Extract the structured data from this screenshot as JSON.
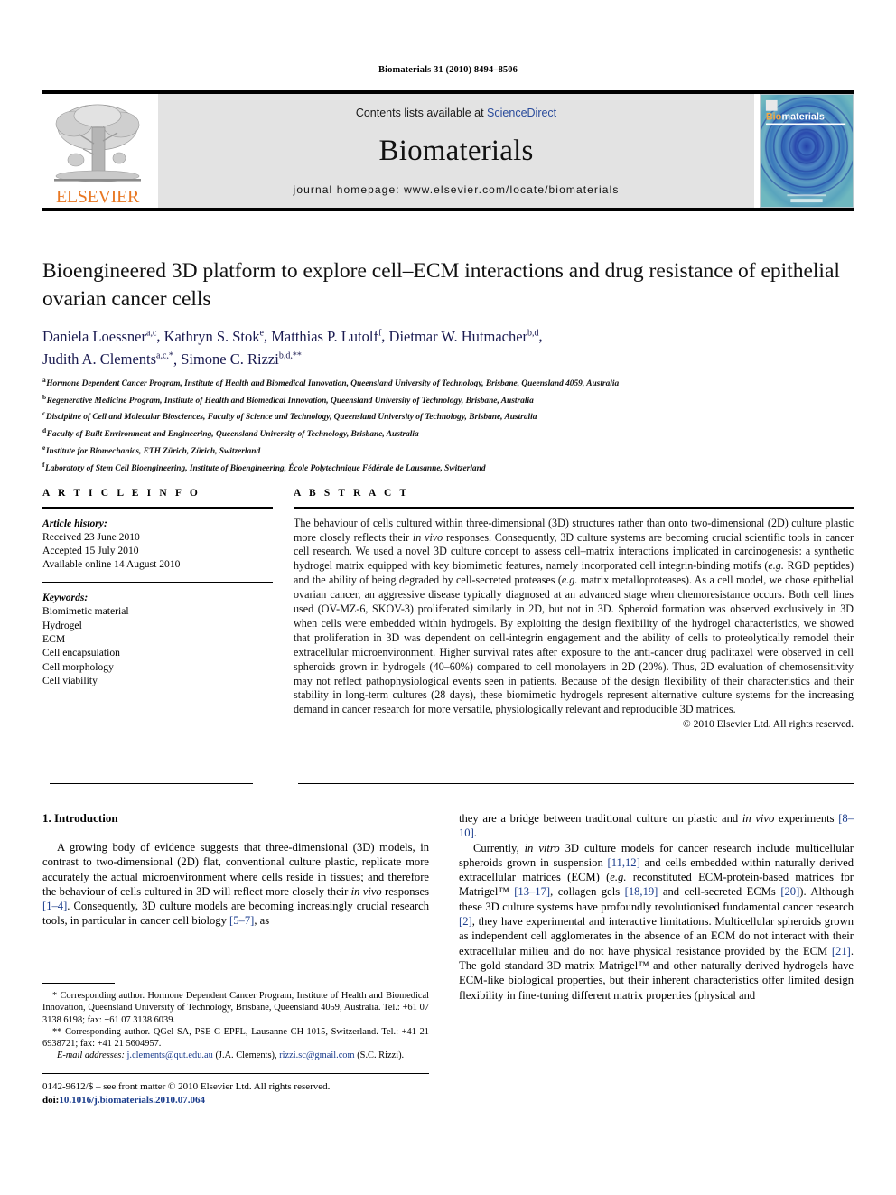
{
  "running_head": "Biomaterials 31 (2010) 8494–8506",
  "masthead": {
    "publisher_name": "ELSEVIER",
    "contents_prefix": "Contents lists available at ",
    "sciencedirect": "ScienceDirect",
    "journal_name": "Biomaterials",
    "homepage": "journal homepage: www.elsevier.com/locate/biomaterials",
    "cover_title_bio": "Bio",
    "cover_title_materials": "materials"
  },
  "article": {
    "title": "Bioengineered 3D platform to explore cell–ECM interactions and drug resistance of epithelial ovarian cancer cells",
    "authors_line1": "Daniela Loessner",
    "authors": [
      {
        "name": "Daniela Loessner",
        "sup": "a,c"
      },
      {
        "name": "Kathryn S. Stok",
        "sup": "e"
      },
      {
        "name": "Matthias P. Lutolf",
        "sup": "f"
      },
      {
        "name": "Dietmar W. Hutmacher",
        "sup": "b,d"
      },
      {
        "name": "Judith A. Clements",
        "sup": "a,c,*"
      },
      {
        "name": "Simone C. Rizzi",
        "sup": "b,d,**"
      }
    ],
    "affiliations": [
      {
        "mark": "a",
        "text": "Hormone Dependent Cancer Program, Institute of Health and Biomedical Innovation, Queensland University of Technology, Brisbane, Queensland 4059, Australia"
      },
      {
        "mark": "b",
        "text": "Regenerative Medicine Program, Institute of Health and Biomedical Innovation, Queensland University of Technology, Brisbane, Australia"
      },
      {
        "mark": "c",
        "text": "Discipline of Cell and Molecular Biosciences, Faculty of Science and Technology, Queensland University of Technology, Brisbane, Australia"
      },
      {
        "mark": "d",
        "text": "Faculty of Built Environment and Engineering, Queensland University of Technology, Brisbane, Australia"
      },
      {
        "mark": "e",
        "text": "Institute for Biomechanics, ETH Zürich, Zürich, Switzerland"
      },
      {
        "mark": "f",
        "text": "Laboratory of Stem Cell Bioengineering, Institute of Bioengineering, École Polytechnique Fédérale de Lausanne, Switzerland"
      }
    ]
  },
  "article_info": {
    "heading": "A R T I C L E   I N F O",
    "history_label": "Article history:",
    "history": [
      "Received 23 June 2010",
      "Accepted 15 July 2010",
      "Available online 14 August 2010"
    ],
    "keywords_label": "Keywords:",
    "keywords": [
      "Biomimetic material",
      "Hydrogel",
      "ECM",
      "Cell encapsulation",
      "Cell morphology",
      "Cell viability"
    ]
  },
  "abstract": {
    "heading": "A B S T R A C T",
    "copyright": "© 2010 Elsevier Ltd. All rights reserved."
  },
  "introduction": {
    "section_number": "1.",
    "section_title": "Introduction"
  },
  "footnotes": {
    "corr1": "* Corresponding author. Hormone Dependent Cancer Program, Institute of Health and Biomedical Innovation, Queensland University of Technology, Brisbane, Queensland 4059, Australia. Tel.: +61 07 3138 6198; fax: +61 07 3138 6039.",
    "corr2": "** Corresponding author. QGel SA, PSE-C EPFL, Lausanne CH-1015, Switzerland. Tel.: +41 21 6938721; fax: +41 21 5604957.",
    "email_label": "E-mail addresses:",
    "email1": "j.clements@qut.edu.au",
    "email1_owner": "(J.A. Clements),",
    "email2": "rizzi.sc@gmail.com",
    "email2_owner": "(S.C. Rizzi)."
  },
  "imprint": {
    "line1": "0142-9612/$ – see front matter © 2010 Elsevier Ltd. All rights reserved.",
    "doi_prefix": "doi:",
    "doi": "10.1016/j.biomaterials.2010.07.064"
  },
  "colors": {
    "elsevier_orange": "#E87722",
    "link_blue": "#1a3c8c",
    "sciencedirect_blue": "#2a4b9b",
    "banner_grey": "#e3e3e3",
    "cover_teal": "#58b0b8"
  }
}
